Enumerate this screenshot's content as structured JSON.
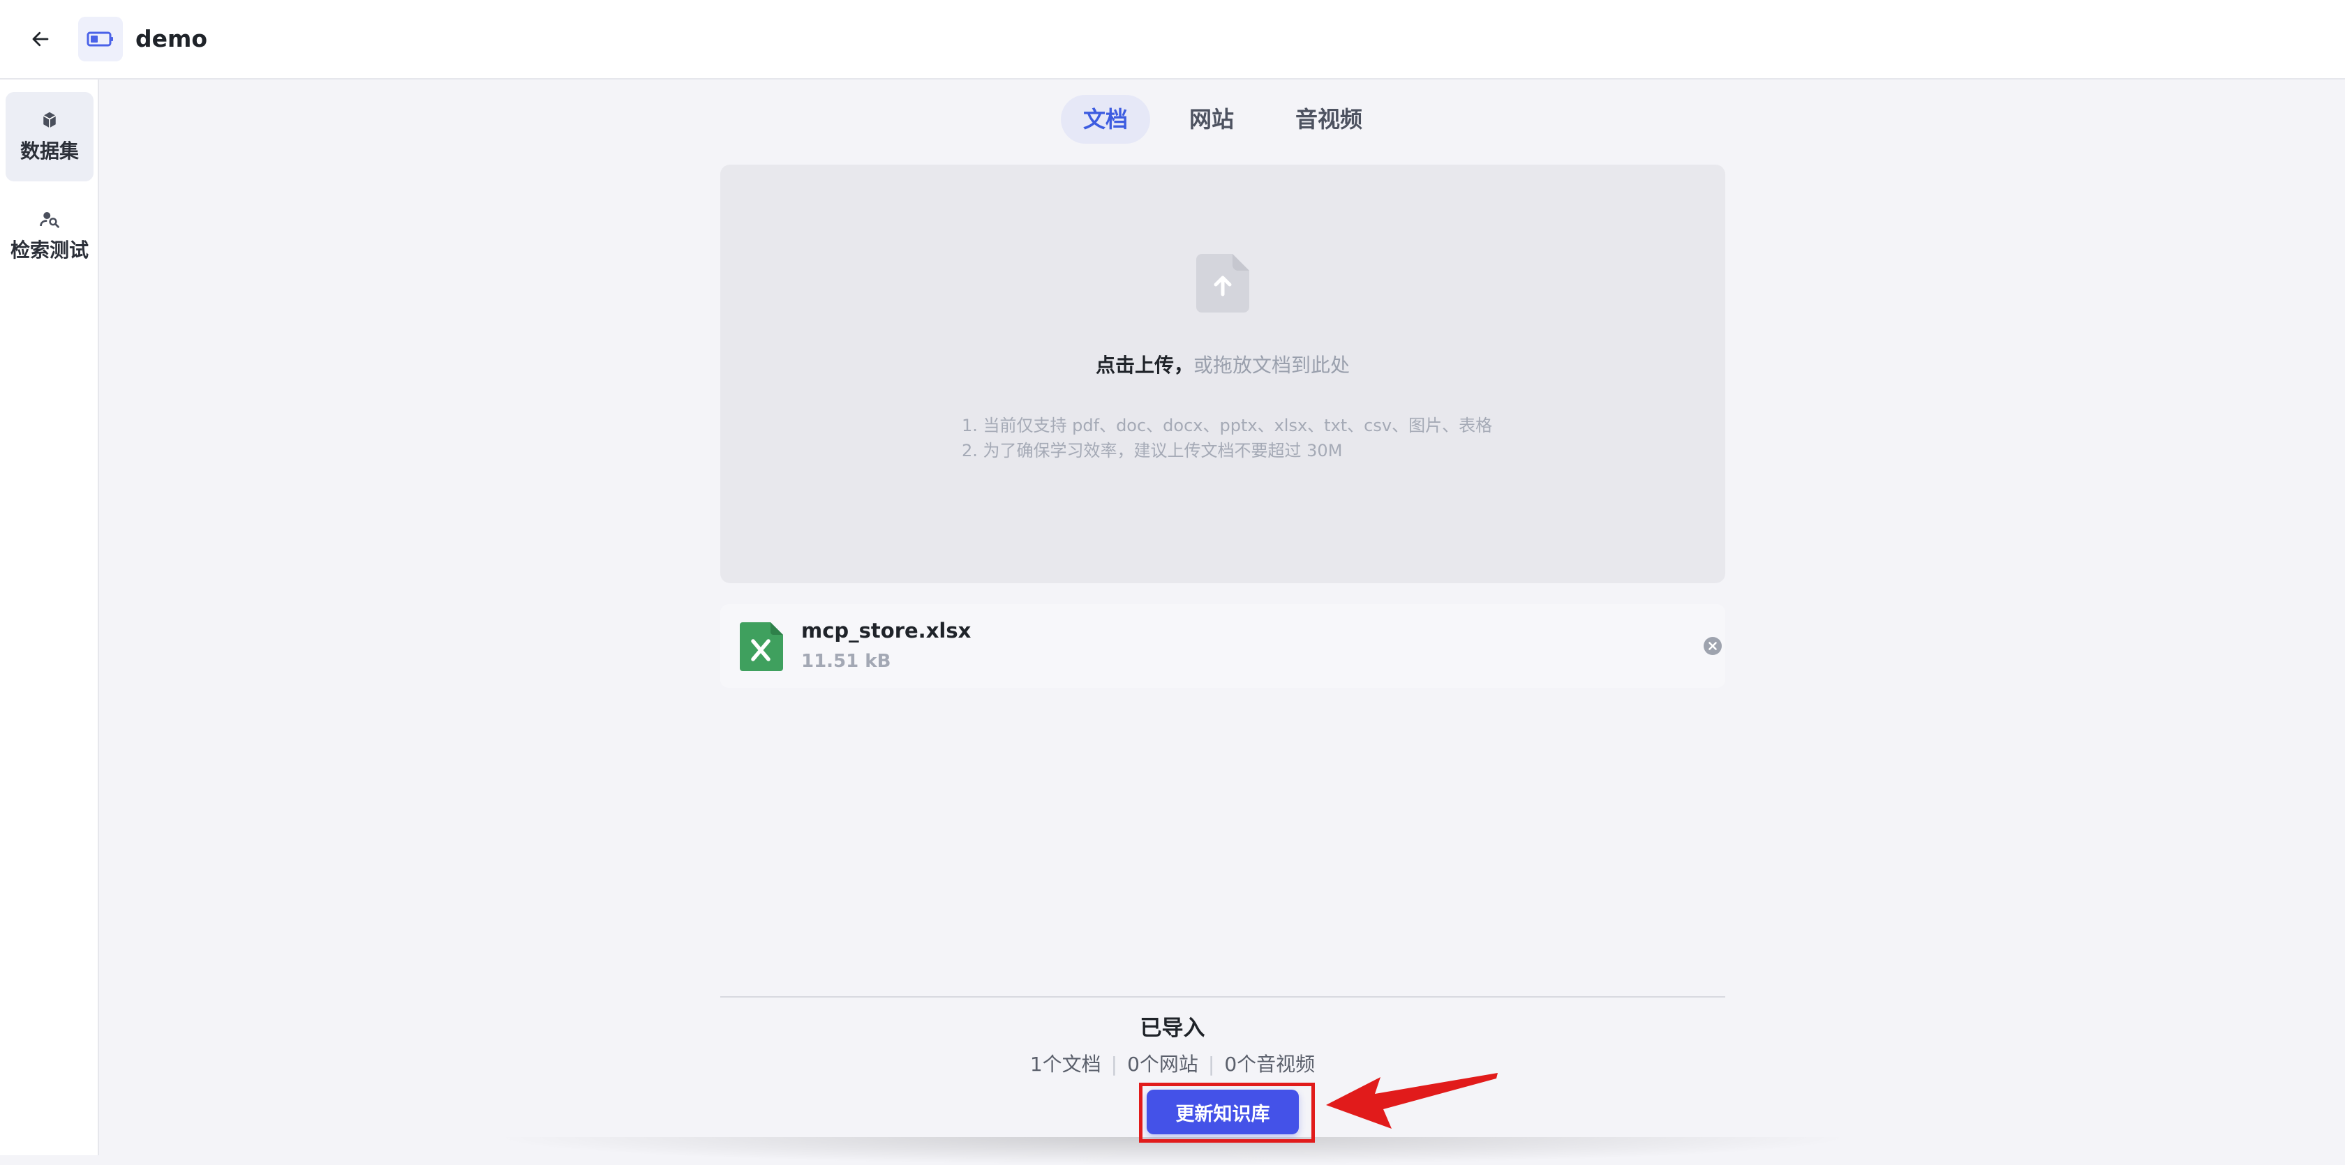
{
  "header": {
    "back_icon": "arrow-left-icon",
    "app_icon": "battery-dataset-icon",
    "title": "demo"
  },
  "sidebar": {
    "items": [
      {
        "label": "数据集",
        "icon": "cube-icon",
        "active": true
      },
      {
        "label": "检索测试",
        "icon": "search-user-icon",
        "active": false
      }
    ]
  },
  "tabs": [
    {
      "label": "文档",
      "active": true
    },
    {
      "label": "网站",
      "active": false
    },
    {
      "label": "音视频",
      "active": false
    }
  ],
  "upload": {
    "icon": "upload-file-icon",
    "main_strong": "点击上传，",
    "main_weak": "或拖放文档到此处",
    "tip1": "1. 当前仅支持 pdf、doc、docx、pptx、xlsx、txt、csv、图片、表格",
    "tip2": "2. 为了确保学习效率，建议上传文档不要超过 30M"
  },
  "files": [
    {
      "name": "mcp_store.xlsx",
      "size": "11.51 kB",
      "icon": "excel-file-icon"
    }
  ],
  "summary": {
    "title": "已导入",
    "docs": "1个文档",
    "sites": "0个网站",
    "media": "0个音视频",
    "separator": "|"
  },
  "actions": {
    "update_label": "更新知识库"
  },
  "colors": {
    "accent": "#4452e8",
    "tab_active_text": "#3d5ce0",
    "annotation": "#e11b1b",
    "excel_green": "#3fa05e"
  }
}
